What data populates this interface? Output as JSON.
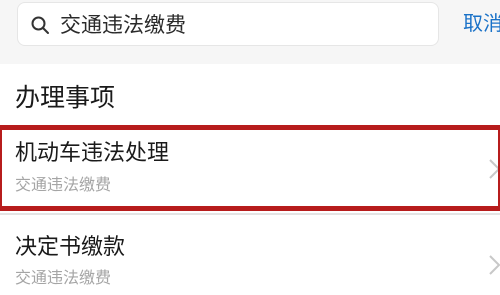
{
  "search": {
    "query": "交通违法缴费",
    "cancel_label": "取消",
    "icon": "search-icon"
  },
  "section": {
    "title": "办理事项"
  },
  "items": [
    {
      "title": "机动车违法处理",
      "subtitle": "交通违法缴费",
      "highlighted": true,
      "icon": "chevron-right-icon"
    },
    {
      "title": "决定书缴款",
      "subtitle": "交通违法缴费",
      "highlighted": false,
      "icon": "chevron-right-icon"
    }
  ],
  "colors": {
    "accent": "#1a72c8",
    "highlight": "#b71c1c",
    "secondary_text": "#a5a5a5"
  }
}
